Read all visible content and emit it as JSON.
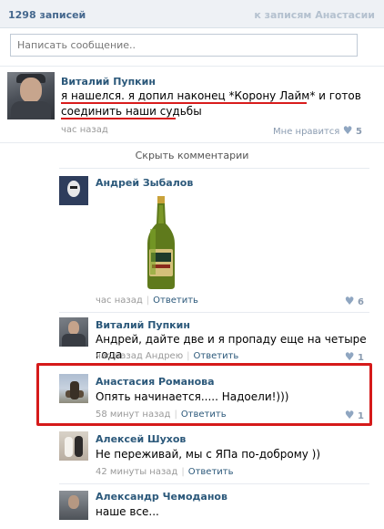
{
  "header": {
    "count": "1298 записей",
    "back_link": "к записям Анастасии"
  },
  "composer": {
    "placeholder": "Написать сообщение.."
  },
  "post": {
    "author": "Виталий Пупкин",
    "text_line1": "я нашелся. я допил наконец *Корону Лайм* и готов",
    "text_line2": "соединить наши судьбы",
    "time": "час назад",
    "like_label": "Мне нравится",
    "likes": "5"
  },
  "collapse_label": "Скрыть комментарии",
  "comments": [
    {
      "author": "Андрей Зыбалов",
      "time": "час назад",
      "reply": "Ответить",
      "likes": "6"
    },
    {
      "author": "Виталий Пупкин",
      "text": "Андрей, дайте две и я пропаду еще на четыре года",
      "time": "час назад Андрею",
      "reply": "Ответить",
      "likes": "1"
    },
    {
      "author": "Анастасия Романова",
      "text": "Опять начинается..... Надоели!)))",
      "time": "58 минут назад",
      "reply": "Ответить",
      "likes": "1"
    },
    {
      "author": "Алексей Шухов",
      "text": "Не переживай, мы с ЯПа по-доброму ))",
      "time": "42 минуты назад",
      "reply": "Ответить"
    },
    {
      "author": "Александр Чемоданов",
      "text": "наше все..."
    }
  ],
  "icons": {
    "like": "heart-icon"
  },
  "colors": {
    "link": "#2b587a",
    "highlight": "#d51a1a",
    "header_bg": "#eef1f5"
  }
}
